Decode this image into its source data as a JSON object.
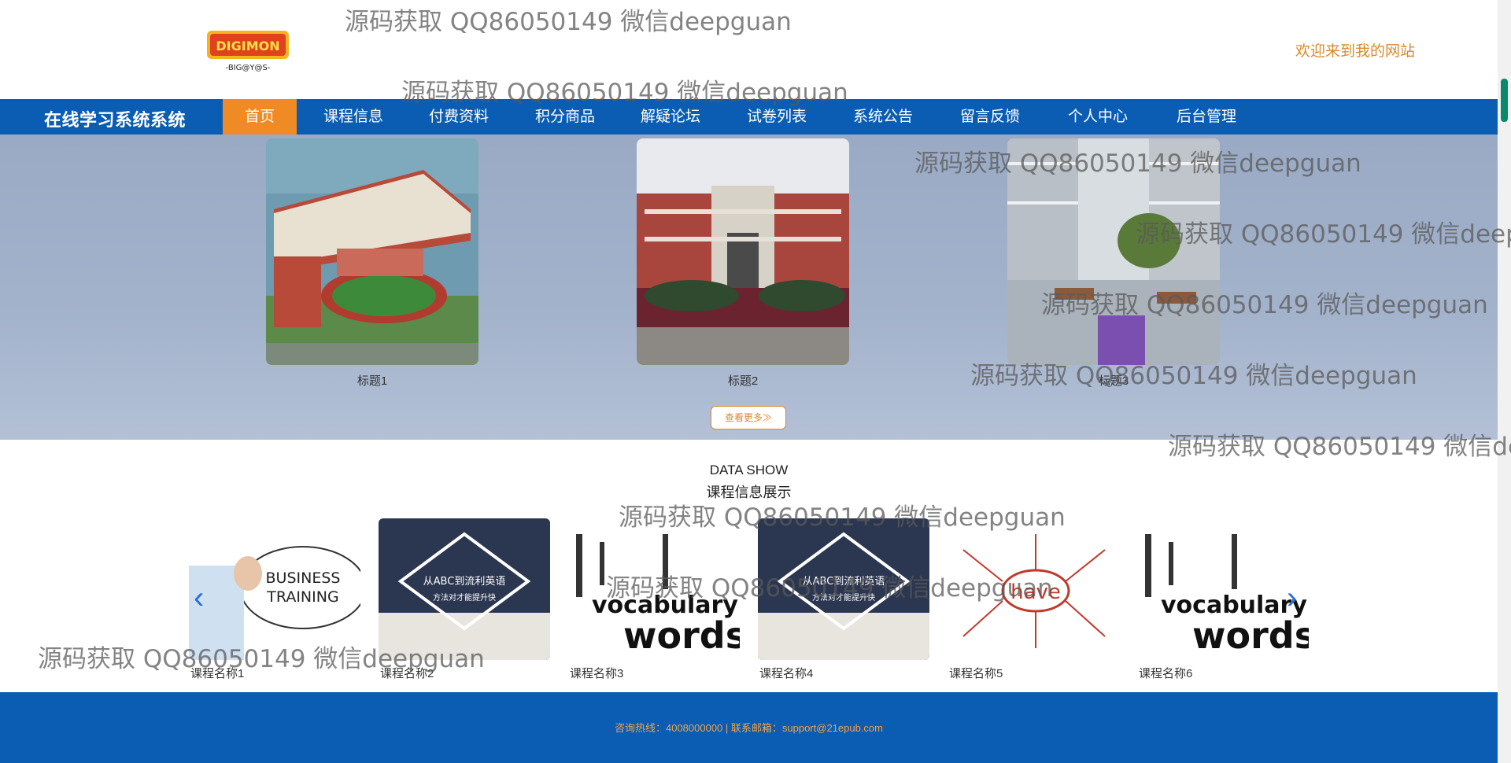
{
  "header": {
    "logo_text": "DIGIMON ADVENTURE -BIG@Y@S-",
    "welcome": "欢迎来到我的网站"
  },
  "nav": {
    "site_title": "在线学习系统系统",
    "items": [
      "首页",
      "课程信息",
      "付费资料",
      "积分商品",
      "解疑论坛",
      "试卷列表",
      "系统公告",
      "留言反馈",
      "个人中心",
      "后台管理"
    ],
    "active": "首页"
  },
  "banner": {
    "cards": [
      {
        "caption": "标题1"
      },
      {
        "caption": "标题2"
      },
      {
        "caption": "标题3"
      }
    ],
    "more_label": "查看更多≫"
  },
  "data_show": {
    "en_title": "DATA SHOW",
    "cn_title": "课程信息展示",
    "courses": [
      {
        "name": "课程名称1",
        "image": "business-training"
      },
      {
        "name": "课程名称2",
        "image": "abc-english"
      },
      {
        "name": "课程名称3",
        "image": "vocabulary-words"
      },
      {
        "name": "课程名称4",
        "image": "abc-english"
      },
      {
        "name": "课程名称5",
        "image": "have-mindmap"
      },
      {
        "name": "课程名称6",
        "image": "vocabulary-words"
      }
    ],
    "card_texts": {
      "business": "BUSINESS",
      "training": "TRAINING",
      "abc1": "从ABC到流利英语",
      "abc2": "方法对才能提升快",
      "vocab": "vocabulary",
      "words": "words",
      "have": "have"
    }
  },
  "footer": {
    "text": "咨询热线：4008000000 | 联系邮箱：support@21epub.com"
  },
  "watermark": "源码获取 QQ86050149 微信deepguan",
  "colors": {
    "nav": "#0a5db3",
    "accent": "#f08a24",
    "welcome": "#d98a2b"
  }
}
